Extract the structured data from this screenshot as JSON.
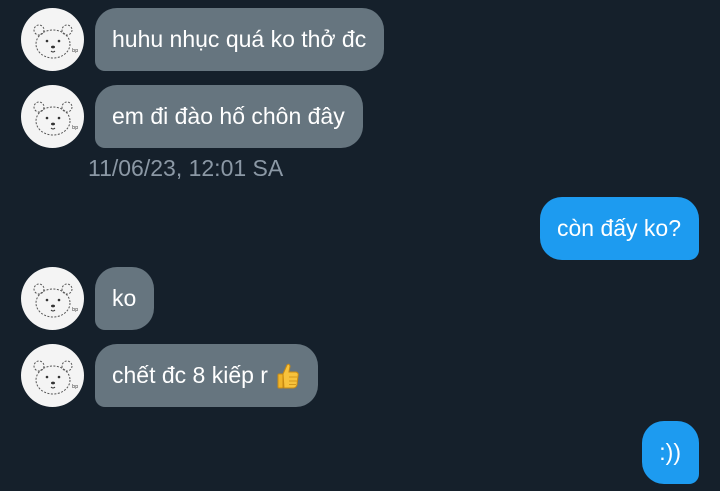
{
  "messages": [
    {
      "id": "m1",
      "direction": "incoming",
      "text": "huhu nhục quá ko thở đc"
    },
    {
      "id": "m2",
      "direction": "incoming",
      "text": "em đi đào hố chôn đây"
    },
    {
      "id": "m3",
      "direction": "outgoing",
      "text": "còn đấy ko?"
    },
    {
      "id": "m4",
      "direction": "incoming",
      "text": "ko"
    },
    {
      "id": "m5",
      "direction": "incoming",
      "text": "chết đc 8 kiếp r",
      "emoji": "thumbs-up-icon"
    },
    {
      "id": "m6",
      "direction": "outgoing",
      "text": ":))"
    }
  ],
  "timestamp": "11/06/23, 12:01 SA",
  "colors": {
    "background": "#15202b",
    "incoming_bubble": "#66757f",
    "outgoing_bubble": "#1d9bf0",
    "timestamp_text": "#8b98a5",
    "avatar_bg": "#f4f4f4"
  },
  "avatar_icon": "bear-sketch-icon"
}
